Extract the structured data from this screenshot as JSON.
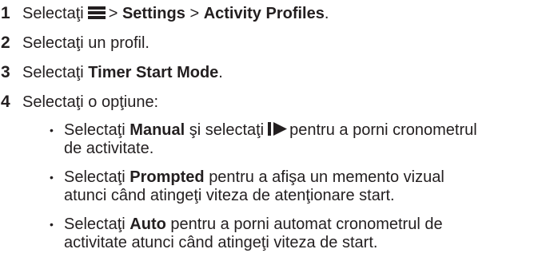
{
  "steps": [
    {
      "number": "1",
      "pre": "Selectaţi",
      "icon": "menu-icon",
      "sep1": ">",
      "bold1": "Settings",
      "sep2": ">",
      "bold2": "Activity Profiles",
      "end": "."
    },
    {
      "number": "2",
      "text": "Selectaţi un profil."
    },
    {
      "number": "3",
      "pre": "Selectaţi",
      "bold": "Timer Start Mode",
      "end": "."
    },
    {
      "number": "4",
      "text": "Selectaţi o opţiune:"
    }
  ],
  "options": [
    {
      "bullet": "•",
      "pre": "Selectaţi",
      "bold": "Manual",
      "mid": "şi selectaţi",
      "icon": "start-stop-icon",
      "line1_end": "pentru a porni cronometrul",
      "line2": "de activitate."
    },
    {
      "bullet": "•",
      "pre": "Selectaţi",
      "bold": "Prompted",
      "line1_end": "pentru a afişa un memento vizual",
      "line2": "atunci când atingeţi viteza de atenţionare start."
    },
    {
      "bullet": "•",
      "pre": "Selectaţi",
      "bold": "Auto",
      "line1_end": "pentru a porni automat cronometrul de",
      "line2": "activitate atunci când atingeţi viteza de start."
    }
  ]
}
